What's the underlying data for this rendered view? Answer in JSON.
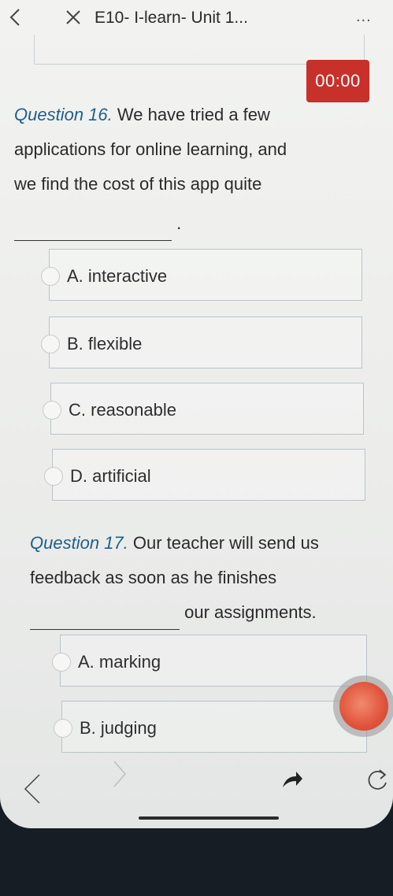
{
  "header": {
    "title": "E10- I-learn- Unit 1...",
    "more": "..."
  },
  "timer": "00:00",
  "questions": [
    {
      "number": "Question 16.",
      "line1": "We have tried a few",
      "line2": "applications for online learning, and",
      "line3": "we find the cost of this app quite",
      "after_blank": ".",
      "options": [
        "A. interactive",
        "B. flexible",
        "C. reasonable",
        "D. artificial"
      ]
    },
    {
      "number": "Question 17.",
      "line1": "Our teacher will send us",
      "line2": "feedback as soon as he finishes",
      "after_blank": "our assignments.",
      "options": [
        "A. marking",
        "B. judging"
      ]
    }
  ],
  "colors": {
    "timer_bg": "#c8302a",
    "question_number": "#1f5f8b",
    "floating_button": "#e0533b"
  },
  "icons": [
    "back-icon",
    "close-icon",
    "more-icon",
    "radio-icon",
    "nav-prev-icon",
    "nav-next-icon",
    "share-icon",
    "reload-icon"
  ]
}
